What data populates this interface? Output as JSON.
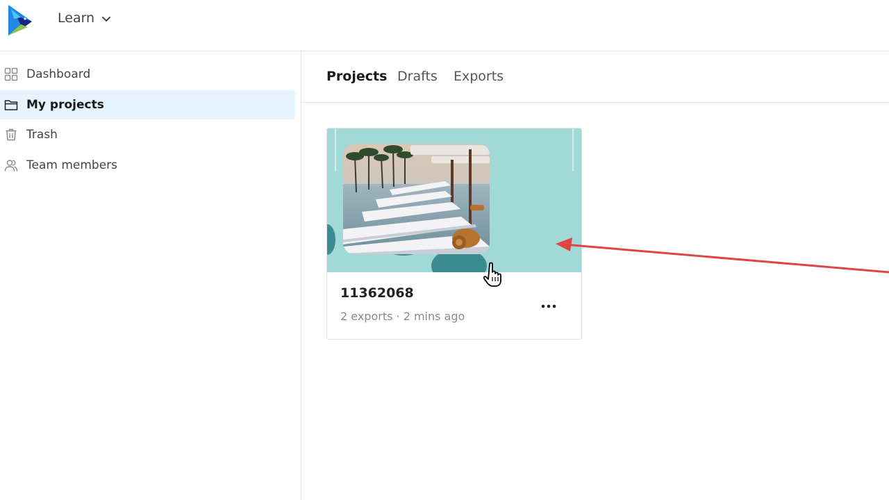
{
  "header": {
    "workspace_label": "Learn",
    "logo_icon": "app-logo-icon",
    "workspace_chevron_icon": "chevron-down-icon"
  },
  "sidebar": {
    "items": [
      {
        "label": "Dashboard",
        "icon": "grid-icon",
        "active": false
      },
      {
        "label": "My projects",
        "icon": "folder-icon",
        "active": true
      },
      {
        "label": "Trash",
        "icon": "trash-icon",
        "active": false
      },
      {
        "label": "Team members",
        "icon": "users-icon",
        "active": false
      }
    ],
    "active_bg": "#e5f3fc"
  },
  "main": {
    "tabs": [
      {
        "label": "Projects",
        "active": true
      },
      {
        "label": "Drafts",
        "active": false
      },
      {
        "label": "Exports",
        "active": false
      }
    ],
    "projects": [
      {
        "title": "11362068",
        "meta": "2 exports · 2 mins ago",
        "thumbnail_bg": "#a0d9d6",
        "thumbnail_icon": "resort-pool-photo",
        "more_icon": "more-horizontal-icon"
      }
    ]
  },
  "annotations": {
    "arrow_color": "#e04444",
    "cursor_icon": "hand-pointer-cursor"
  }
}
